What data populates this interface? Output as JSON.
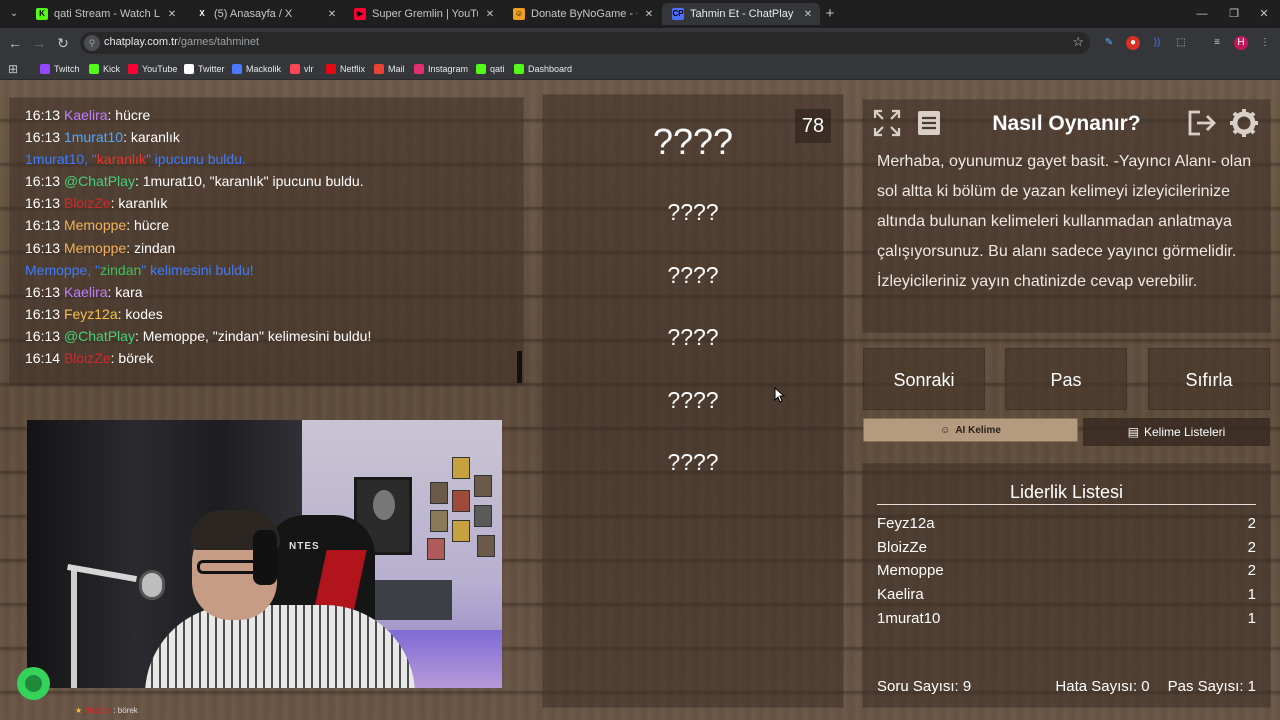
{
  "browser": {
    "tabs": [
      {
        "title": "qati Stream - Watch Live on Kick",
        "favicon_color": "#53fc18",
        "favicon_glyph": "K",
        "active": false
      },
      {
        "title": "(5) Anasayfa / X",
        "favicon_color": "#ffffff",
        "favicon_glyph": "X",
        "active": false
      },
      {
        "title": "Super Gremlin | YouTube Music",
        "favicon_color": "#ff0033",
        "favicon_glyph": "▶",
        "active": false
      },
      {
        "title": "Donate ByNoGame - Gelen/Giden",
        "favicon_color": "#f0a020",
        "favicon_glyph": "☺",
        "active": false
      },
      {
        "title": "Tahmin Et - ChatPlay",
        "favicon_color": "#4c6fff",
        "favicon_glyph": "CP",
        "active": true
      }
    ],
    "url_host": "chatplay.com.tr",
    "url_path": "/games/tahminet",
    "bookmarks": [
      {
        "label": "Twitch",
        "color": "#9146ff"
      },
      {
        "label": "Kick",
        "color": "#53fc18"
      },
      {
        "label": "YouTube",
        "color": "#ff0033"
      },
      {
        "label": "Twitter",
        "color": "#ffffff"
      },
      {
        "label": "Mackolik",
        "color": "#4a78ff"
      },
      {
        "label": "vlr",
        "color": "#ff4655"
      },
      {
        "label": "Netflix",
        "color": "#e50914"
      },
      {
        "label": "Mail",
        "color": "#ea4335"
      },
      {
        "label": "Instagram",
        "color": "#e1306c"
      },
      {
        "label": "qati",
        "color": "#53fc18"
      },
      {
        "label": "Dashboard",
        "color": "#53fc18"
      }
    ],
    "profile_initial": "H"
  },
  "chat": {
    "messages": [
      {
        "time": "16:13",
        "user": "Kaelira",
        "user_color": "#c17dff",
        "text": ": hücre"
      },
      {
        "time": "16:13",
        "user": "1murat10",
        "user_color": "#52a8ff",
        "text": ": karanlık"
      },
      {
        "system": true,
        "parts": [
          {
            "text": "1murat10",
            "color": "#3d7bff"
          },
          {
            "text": ", \"",
            "color": "#3d7bff"
          },
          {
            "text": "karanlık",
            "color": "#e8352a"
          },
          {
            "text": "\" ipucunu buldu.",
            "color": "#3d7bff"
          }
        ]
      },
      {
        "time": "16:13",
        "user": "@ChatPlay",
        "user_color": "#46d17a",
        "text": ": 1murat10, \"karanlık\" ipucunu buldu."
      },
      {
        "time": "16:13",
        "user": "BloizZe",
        "user_color": "#d3262c",
        "text": ": karanlık"
      },
      {
        "time": "16:13",
        "user": "Memoppe",
        "user_color": "#f2b15c",
        "text": ": hücre"
      },
      {
        "time": "16:13",
        "user": "Memoppe",
        "user_color": "#f2b15c",
        "text": ": zindan"
      },
      {
        "system": true,
        "parts": [
          {
            "text": "Memoppe",
            "color": "#3d7bff"
          },
          {
            "text": ", \"",
            "color": "#3d7bff"
          },
          {
            "text": "zindan",
            "color": "#41c05b"
          },
          {
            "text": "\" kelimesini buldu!",
            "color": "#3d7bff"
          }
        ]
      },
      {
        "time": "16:13",
        "user": "Kaelira",
        "user_color": "#c17dff",
        "text": ": kara"
      },
      {
        "time": "16:13",
        "user": "Feyz12a",
        "user_color": "#f5c04a",
        "text": ": kodes"
      },
      {
        "time": "16:13",
        "user": "@ChatPlay",
        "user_color": "#46d17a",
        "text": ": Memoppe, \"zindan\" kelimesini buldu!"
      },
      {
        "time": "16:14",
        "user": "BloizZe",
        "user_color": "#d3262c",
        "text": ": börek"
      }
    ]
  },
  "stream_overlay": {
    "chat_user": "BloizZe",
    "chat_text": "börek",
    "cam_text": "NTES"
  },
  "game": {
    "counter": "78",
    "main_word": "????",
    "hints": [
      "????",
      "????",
      "????",
      "????",
      "????"
    ]
  },
  "howto": {
    "title": "Nasıl Oynanır?",
    "text": "Merhaba, oyunumuz gayet basit. -Yayıncı Alanı- olan sol altta ki bölüm de yazan kelimeyi izleyicilerinize altında bulunan kelimeleri kullanmadan anlatmaya çalışıyorsunuz. Bu alanı sadece yayıncı görmelidir. İzleyicileriniz yayın chatinizde cevap verebilir."
  },
  "actions": {
    "next": "Sonraki",
    "pass": "Pas",
    "reset": "Sıfırla",
    "ai_word": "AI Kelime",
    "word_lists": "Kelime Listeleri"
  },
  "leaderboard": {
    "title": "Liderlik Listesi",
    "rows": [
      {
        "name": "Feyz12a",
        "score": "2"
      },
      {
        "name": "BloizZe",
        "score": "2"
      },
      {
        "name": "Memoppe",
        "score": "2"
      },
      {
        "name": "Kaelira",
        "score": "1"
      },
      {
        "name": "1murat10",
        "score": "1"
      }
    ],
    "question_count": "Soru Sayısı: 9",
    "error_count": "Hata Sayısı: 0",
    "pass_count": "Pas Sayısı: 1"
  }
}
